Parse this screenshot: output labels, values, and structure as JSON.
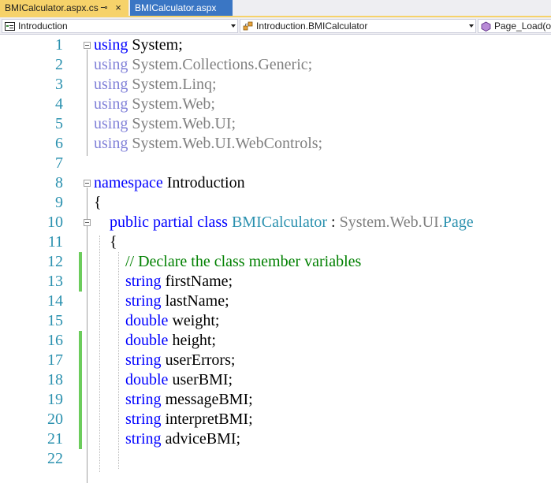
{
  "tabs": [
    {
      "label": "BMICalculator.aspx.cs",
      "active": true,
      "pin_icon": "pin-icon",
      "close_icon": "close-icon"
    },
    {
      "label": "BMICalculator.aspx",
      "active": false
    }
  ],
  "navbar": {
    "project": "Introduction",
    "class": "Introduction.BMICalculator",
    "member": "Page_Load(ob"
  },
  "editor": {
    "lines": [
      {
        "n": "1",
        "tokens": [
          {
            "t": "using",
            "c": "kw"
          },
          {
            "t": " System;",
            "c": ""
          }
        ]
      },
      {
        "n": "2",
        "tokens": [
          {
            "t": "using",
            "c": "kwd"
          },
          {
            "t": " System.Collections.Generic;",
            "c": "gray"
          }
        ]
      },
      {
        "n": "3",
        "tokens": [
          {
            "t": "using",
            "c": "kwd"
          },
          {
            "t": " System.Linq;",
            "c": "gray"
          }
        ]
      },
      {
        "n": "4",
        "tokens": [
          {
            "t": "using",
            "c": "kwd"
          },
          {
            "t": " System.Web;",
            "c": "gray"
          }
        ]
      },
      {
        "n": "5",
        "tokens": [
          {
            "t": "using",
            "c": "kwd"
          },
          {
            "t": " System.Web.UI;",
            "c": "gray"
          }
        ]
      },
      {
        "n": "6",
        "tokens": [
          {
            "t": "using",
            "c": "kwd"
          },
          {
            "t": " System.Web.UI.WebControls;",
            "c": "gray"
          }
        ]
      },
      {
        "n": "7",
        "tokens": []
      },
      {
        "n": "8",
        "tokens": [
          {
            "t": "namespace",
            "c": "kw"
          },
          {
            "t": " Introduction",
            "c": ""
          }
        ]
      },
      {
        "n": "9",
        "tokens": [
          {
            "t": "{",
            "c": ""
          }
        ]
      },
      {
        "n": "10",
        "tokens": [
          {
            "t": "    ",
            "c": ""
          },
          {
            "t": "public partial class",
            "c": "kw"
          },
          {
            "t": " ",
            "c": ""
          },
          {
            "t": "BMICalculator",
            "c": "type"
          },
          {
            "t": " : ",
            "c": ""
          },
          {
            "t": "System.Web.UI.",
            "c": "gray"
          },
          {
            "t": "Page",
            "c": "type"
          }
        ]
      },
      {
        "n": "11",
        "tokens": [
          {
            "t": "    {",
            "c": ""
          }
        ]
      },
      {
        "n": "12",
        "tokens": [
          {
            "t": "        // Declare the class member variables",
            "c": "comment"
          }
        ]
      },
      {
        "n": "13",
        "tokens": [
          {
            "t": "        ",
            "c": ""
          },
          {
            "t": "string",
            "c": "kw"
          },
          {
            "t": " firstName;",
            "c": ""
          }
        ]
      },
      {
        "n": "14",
        "tokens": [
          {
            "t": "        ",
            "c": ""
          },
          {
            "t": "string",
            "c": "kw"
          },
          {
            "t": " lastName;",
            "c": ""
          }
        ]
      },
      {
        "n": "15",
        "tokens": [
          {
            "t": "        ",
            "c": ""
          },
          {
            "t": "double",
            "c": "kw"
          },
          {
            "t": " weight;",
            "c": ""
          }
        ]
      },
      {
        "n": "16",
        "tokens": [
          {
            "t": "        ",
            "c": ""
          },
          {
            "t": "double",
            "c": "kw"
          },
          {
            "t": " height;",
            "c": ""
          }
        ]
      },
      {
        "n": "17",
        "tokens": [
          {
            "t": "        ",
            "c": ""
          },
          {
            "t": "string",
            "c": "kw"
          },
          {
            "t": " userErrors;",
            "c": ""
          }
        ]
      },
      {
        "n": "18",
        "tokens": [
          {
            "t": "        ",
            "c": ""
          },
          {
            "t": "double",
            "c": "kw"
          },
          {
            "t": " userBMI;",
            "c": ""
          }
        ]
      },
      {
        "n": "19",
        "tokens": [
          {
            "t": "        ",
            "c": ""
          },
          {
            "t": "string",
            "c": "kw"
          },
          {
            "t": " messageBMI;",
            "c": ""
          }
        ]
      },
      {
        "n": "20",
        "tokens": [
          {
            "t": "        ",
            "c": ""
          },
          {
            "t": "string",
            "c": "kw"
          },
          {
            "t": " interpretBMI;",
            "c": ""
          }
        ]
      },
      {
        "n": "21",
        "tokens": [
          {
            "t": "        ",
            "c": ""
          },
          {
            "t": "string",
            "c": "kw"
          },
          {
            "t": " adviceBMI;",
            "c": ""
          }
        ]
      },
      {
        "n": "22",
        "tokens": []
      }
    ],
    "changed_lines": [
      "12",
      "13",
      "16",
      "17",
      "18",
      "19",
      "20",
      "21"
    ],
    "folded_lines": [
      "1",
      "8",
      "10"
    ]
  },
  "colors": {
    "keyword": "#0000ff",
    "type": "#2b91af",
    "comment": "#008000",
    "line_number": "#2b91af",
    "change_marker": "#6ccc5c",
    "active_tab": "#f6d26a",
    "inactive_tab": "#3a76c4"
  }
}
